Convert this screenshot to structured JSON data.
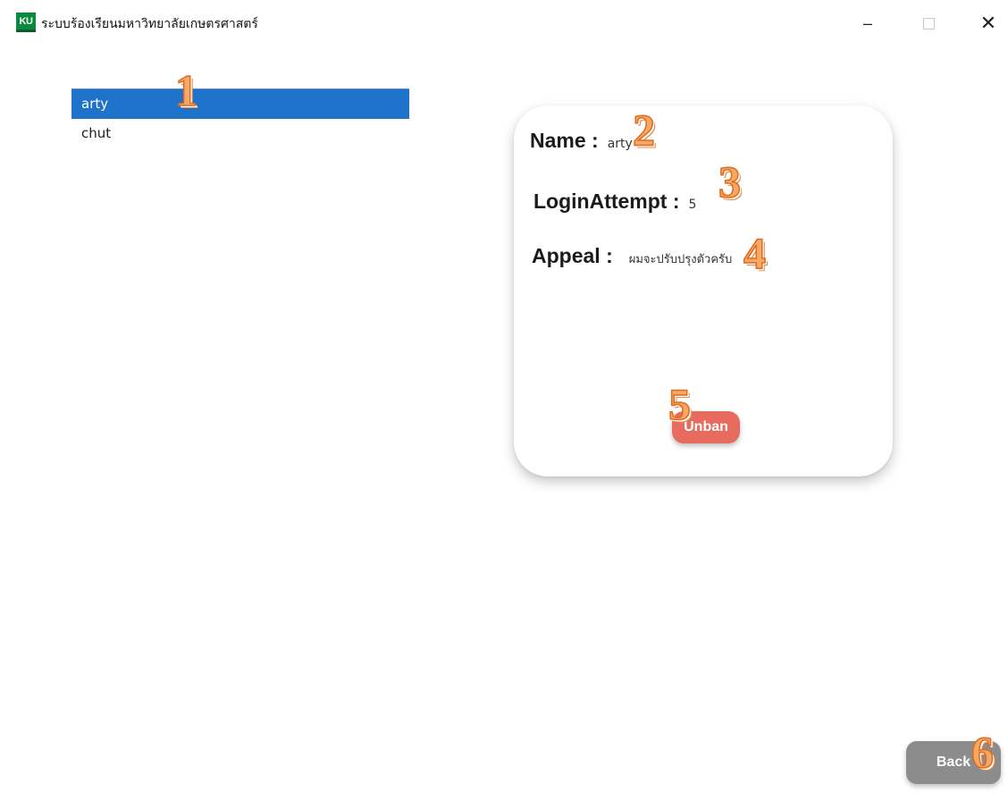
{
  "window": {
    "icon_text": "KU",
    "title": "ระบบร้องเรียนมหาวิทยาลัยเกษตรศาสตร์",
    "controls": {
      "minimize": "–",
      "close": "✕"
    }
  },
  "user_list": {
    "items": [
      {
        "label": "arty",
        "selected": true
      },
      {
        "label": "chut",
        "selected": false
      }
    ]
  },
  "details": {
    "name_label": "Name :",
    "name_value": "arty",
    "login_attempt_label": "LoginAttempt :",
    "login_attempt_value": "5",
    "appeal_label": "Appeal :",
    "appeal_value": "ผมจะปรับปรุงตัวครับ"
  },
  "buttons": {
    "unban": "Unban",
    "back": "Back"
  },
  "annotations": [
    "1",
    "2",
    "3",
    "4",
    "5",
    "6"
  ],
  "colors": {
    "selected_item": "#1f72c9",
    "unban_button": "#e86b5f",
    "back_button": "#8c8c8c",
    "marker": "#f5a964"
  }
}
